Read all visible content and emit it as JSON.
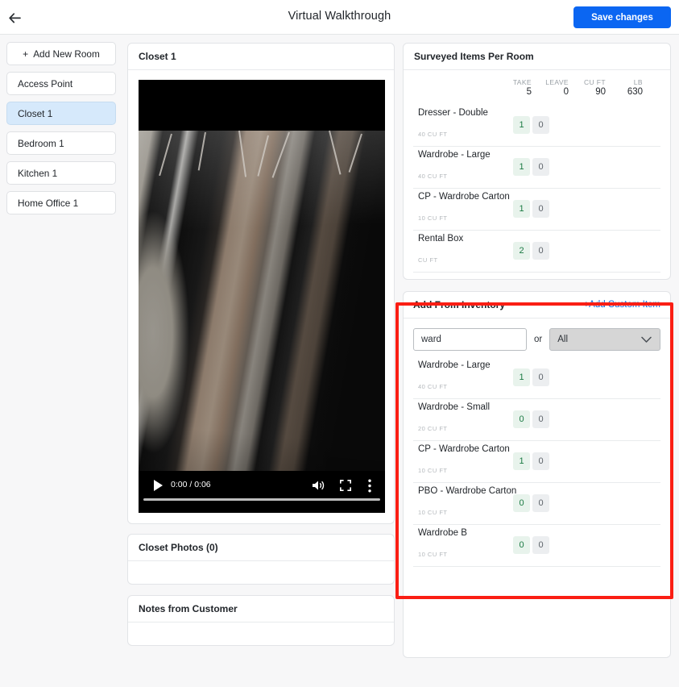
{
  "topbar": {
    "back_icon": "arrow-left-icon",
    "title": "Virtual Walkthrough",
    "save_label": "Save changes",
    "accent_blue": "#0b66f2"
  },
  "sidebar": {
    "add_room": {
      "plus": "+",
      "label": "Add New Room"
    },
    "rooms": [
      {
        "label": "Access Point",
        "active": false
      },
      {
        "label": "Closet 1",
        "active": true
      },
      {
        "label": "Bedroom 1",
        "active": false
      },
      {
        "label": "Kitchen 1",
        "active": false
      },
      {
        "label": "Home Office 1",
        "active": false
      }
    ],
    "active_bg": "#d6e9fb"
  },
  "room_panel": {
    "title": "Closet 1",
    "video": {
      "play_icon": "play-icon",
      "time": "0:00 / 0:06",
      "volume_icon": "volume-icon",
      "fullscreen_icon": "fullscreen-icon",
      "more_icon": "more-vertical-icon",
      "progress_percent": 0
    },
    "photos_title": "Closet Photos (0)",
    "notes_title": "Notes from Customer"
  },
  "surveyed": {
    "title": "Surveyed Items Per Room",
    "stats": [
      {
        "label": "TAKE",
        "value": "5"
      },
      {
        "label": "LEAVE",
        "value": "0"
      },
      {
        "label": "CU FT",
        "value": "90"
      },
      {
        "label": "LB",
        "value": "630"
      }
    ],
    "items": [
      {
        "name": "Dresser - Double",
        "sub": "40 CU FT",
        "take": "1",
        "leave": "0"
      },
      {
        "name": "Wardrobe - Large",
        "sub": "40 CU FT",
        "take": "1",
        "leave": "0"
      },
      {
        "name": "CP - Wardrobe Carton",
        "sub": "10 CU FT",
        "take": "1",
        "leave": "0"
      },
      {
        "name": "Rental Box",
        "sub": "CU FT",
        "take": "2",
        "leave": "0"
      }
    ]
  },
  "inventory": {
    "title": "Add From Inventory",
    "add_custom_label": "+Add Custom Item",
    "add_custom_color": "#1065d8",
    "search_value": "ward",
    "search_placeholder": "",
    "or_label": "or",
    "category_selected": "All",
    "chevron_icon": "chevron-down-icon",
    "items": [
      {
        "name": "Wardrobe - Large",
        "sub": "40 CU FT",
        "take": "1",
        "leave": "0"
      },
      {
        "name": "Wardrobe - Small",
        "sub": "20 CU FT",
        "take": "0",
        "leave": "0"
      },
      {
        "name": "CP - Wardrobe Carton",
        "sub": "10 CU FT",
        "take": "1",
        "leave": "0"
      },
      {
        "name": "PBO - Wardrobe Carton",
        "sub": "10 CU FT",
        "take": "0",
        "leave": "0"
      },
      {
        "name": "Wardrobe B",
        "sub": "10 CU FT",
        "take": "0",
        "leave": "0"
      }
    ]
  },
  "highlight": {
    "color": "#fa1e14"
  }
}
